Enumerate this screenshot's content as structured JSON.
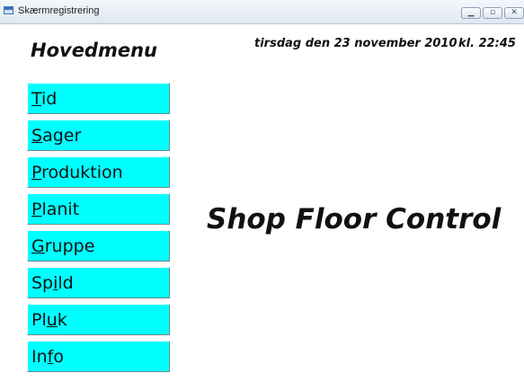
{
  "window": {
    "title": "Skærmregistrering",
    "controls": {
      "minimize_icon": "minimize-icon",
      "maximize_icon": "maximize-icon",
      "close_icon": "close-icon"
    }
  },
  "header": {
    "title": "Hovedmenu",
    "date": "tirsdag den 23 november 2010",
    "time": "kl. 22:45"
  },
  "menu": [
    {
      "label": "Tid",
      "mnemonic": "T"
    },
    {
      "label": "Sager",
      "mnemonic": "S"
    },
    {
      "label": "Produktion",
      "mnemonic": "P"
    },
    {
      "label": "Planit",
      "mnemonic": "P"
    },
    {
      "label": "Gruppe",
      "mnemonic": "G"
    },
    {
      "label": "Spild",
      "mnemonic": "i"
    },
    {
      "label": "Pluk",
      "mnemonic": "u"
    },
    {
      "label": "Info",
      "mnemonic": "f"
    }
  ],
  "main": {
    "brand": "Shop Floor Control"
  },
  "colors": {
    "menu_button": "#00ffff",
    "text": "#111111",
    "background": "#ffffff"
  }
}
